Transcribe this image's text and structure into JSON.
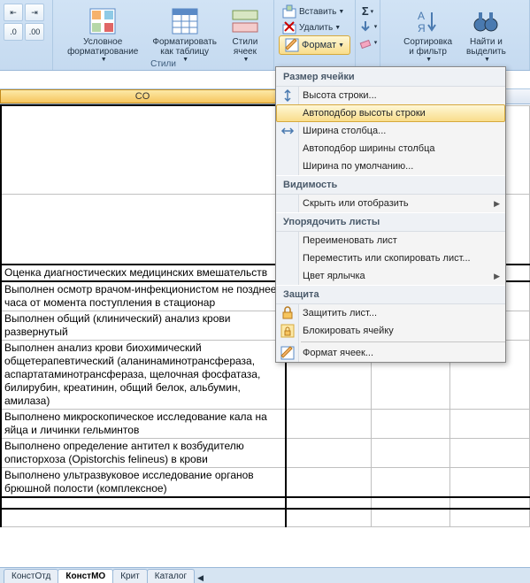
{
  "ribbon": {
    "frag_labels": [
      "",
      "",
      ""
    ],
    "conditional_fmt": "Условное\nформатирование",
    "format_table": "Форматировать\nкак таблицу",
    "cell_styles": "Стили\nячеек",
    "styles_group": "Стили",
    "insert": "Вставить",
    "delete": "Удалить",
    "format": "Формат",
    "sigma": "Σ",
    "fill": "",
    "clear": "",
    "sort_filter": "Сортировка\nи фильтр",
    "find_select": "Найти и\nвыделить"
  },
  "dropdown": {
    "sec1": "Размер ячейки",
    "row_height": "Высота строки...",
    "autofit_row": "Автоподбор высоты строки",
    "col_width": "Ширина столбца...",
    "autofit_col": "Автоподбор ширины столбца",
    "default_width": "Ширина по умолчанию...",
    "sec2": "Видимость",
    "hide_unhide": "Скрыть или отобразить",
    "sec3": "Упорядочить листы",
    "rename": "Переименовать лист",
    "move_copy": "Переместить или скопировать лист...",
    "tab_color": "Цвет ярлычка",
    "sec4": "Защита",
    "protect_sheet": "Защитить лист...",
    "lock_cell": "Блокировать ячейку",
    "format_cells": "Формат ячеек..."
  },
  "col_header": "CO",
  "cells": [
    "",
    "",
    "Оценка диагностических медицинских вмешательств",
    "Выполнен осмотр врачом-инфекционистом не позднее часа от момента поступления в стационар",
    "Выполнен общий (клинический) анализ крови развернутый",
    "Выполнен анализ крови биохимический общетерапевтический (аланинаминотрансфераза, аспартатаминотрансфераза, щелочная фосфатаза, билирубин, креатинин, общий белок, альбумин, амилаза)",
    "Выполнено микроскопическое исследование кала на яйца и личинки гельминтов",
    "Выполнено определение антител к возбудителю описторхоза (Opistorchis felineus) в крови",
    "Выполнено ультразвуковое исследование органов брюшной полости (комплексное)",
    ""
  ],
  "tabs": [
    "КонстОтд",
    "КонстМО",
    "Крит",
    "Каталог"
  ]
}
